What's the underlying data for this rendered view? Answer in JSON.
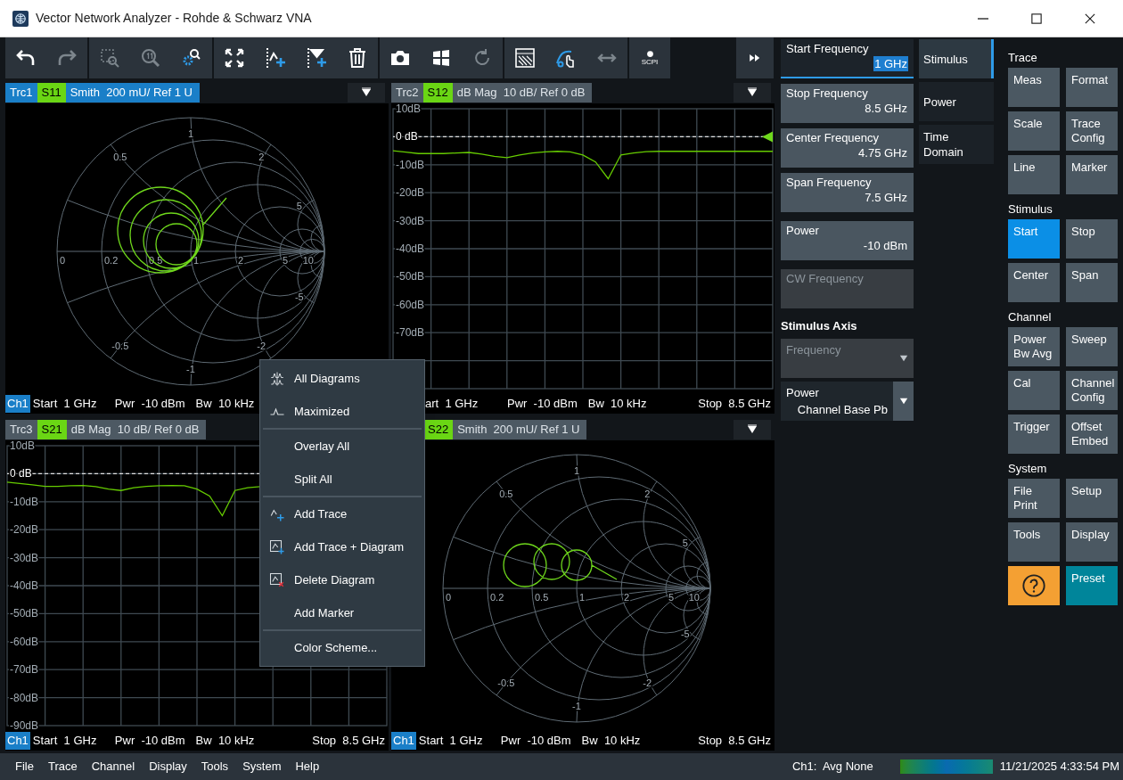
{
  "window": {
    "title": "Vector Network Analyzer - Rohde & Schwarz VNA"
  },
  "toolbar": {
    "groups": [
      [
        {
          "disabled": false
        },
        {
          "disabled": true
        }
      ],
      [
        {
          "disabled": true
        },
        {
          "disabled": true
        },
        {
          "disabled": false
        }
      ],
      [
        {
          "disabled": false
        },
        {
          "disabled": false
        },
        {
          "disabled": false
        },
        {
          "disabled": false
        }
      ],
      [
        {
          "disabled": false
        },
        {
          "disabled": false
        },
        {
          "disabled": true
        }
      ],
      [
        {
          "disabled": false
        },
        {
          "disabled": false
        },
        {
          "disabled": true
        }
      ],
      [
        {
          "disabled": false,
          "label": "SCPI"
        }
      ]
    ]
  },
  "diagrams": [
    {
      "kind": "smith",
      "header": {
        "selected": true,
        "trace": "Trc1",
        "parameter": "S11",
        "format": "Smith  200 mU/ Ref 1 U",
        "dropdown": true
      },
      "grid_labels": [
        "0",
        "0.2",
        "0.5",
        "1",
        "2",
        "5",
        "10",
        "0.5",
        "1",
        "2",
        "5",
        "-0.5",
        "-1",
        "-2",
        "-5"
      ],
      "footer": {
        "channel": "Ch1",
        "start": "Start  1 GHz",
        "power": "Pwr  -10 dBm",
        "bandwidth": "Bw  10 kHz"
      }
    },
    {
      "kind": "line",
      "header": {
        "selected": false,
        "trace": "Trc2",
        "format": "dB Mag  10 dB/ Ref 0 dB",
        "dropdown": true
      },
      "ref_marker": true,
      "chart_data": {
        "type": "line",
        "categories": [
          null,
          null,
          null,
          null,
          null,
          null,
          null,
          null,
          null,
          null,
          null,
          null,
          null,
          null,
          null,
          null,
          null,
          null,
          null,
          null,
          null,
          null,
          null,
          null,
          null,
          null,
          null,
          null,
          null,
          null,
          null
        ],
        "series": [
          {
            "name": "S12",
            "color": "#66cc00",
            "values": [
              -5,
              -5.5,
              -6,
              -6,
              -6,
              -5.8,
              -5.6,
              -6.2,
              -7,
              -7.5,
              -6.5,
              -5.8,
              -5.4,
              -5.2,
              -5.4,
              -6.5,
              -9,
              -15,
              -6.5,
              -5.8,
              -5.3,
              -5.2,
              -5.2,
              -5.2,
              -5.2,
              -5.2,
              -5.2,
              -5.2,
              -5.2,
              -5.2,
              -5.2
            ]
          }
        ],
        "grid": true,
        "ref_lines": [
          {
            "axis": "y",
            "value": 0
          }
        ],
        "ylim": [
          -90,
          10
        ],
        "yticks": [
          {
            "value": 10,
            "label": "10dB"
          },
          {
            "value": 0,
            "label": "0 dB"
          },
          {
            "value": -10,
            "label": "-10dB"
          },
          {
            "value": -20,
            "label": "-20dB"
          },
          {
            "value": -30,
            "label": "-30dB"
          },
          {
            "value": -40,
            "label": "-40dB"
          },
          {
            "value": -50,
            "label": "-50dB"
          },
          {
            "value": -60,
            "label": "-60dB"
          },
          {
            "value": -70,
            "label": "-70dB"
          }
        ]
      },
      "footer": {
        "start": "art  1 GHz",
        "power": "Pwr  -10 dBm",
        "bandwidth": "Bw  10 kHz",
        "stop": "Stop  8.5 GHz"
      }
    },
    {
      "kind": "line",
      "header": {
        "selected": false,
        "trace": "Trc3",
        "format": "dB Mag  10 dB/ Ref 0 dB",
        "dropdown": false
      },
      "ref_marker": false,
      "chart_data": {
        "type": "line",
        "categories": [
          null,
          null,
          null,
          null,
          null,
          null,
          null,
          null,
          null,
          null,
          null,
          null,
          null,
          null,
          null,
          null,
          null,
          null,
          null,
          null,
          null,
          null,
          null,
          null,
          null,
          null,
          null,
          null,
          null,
          null,
          null
        ],
        "series": [
          {
            "name": "S21",
            "color": "#66cc00",
            "values": [
              -3,
              -3.5,
              -4,
              -4.5,
              -4.5,
              -4.3,
              -4.2,
              -4.6,
              -5.5,
              -6,
              -5,
              -4.5,
              -4.3,
              -4.2,
              -4.3,
              -5.5,
              -8,
              -15,
              -6,
              -5,
              -4.6,
              null,
              null,
              null,
              null,
              null,
              null,
              null,
              null,
              null,
              null
            ]
          }
        ],
        "grid": true,
        "ref_lines": [
          {
            "axis": "y",
            "value": 0
          }
        ],
        "ylim": [
          -90,
          10
        ],
        "yticks": [
          {
            "value": 10,
            "label": "10dB"
          },
          {
            "value": 0,
            "label": "0 dB"
          },
          {
            "value": -10,
            "label": "-10dB"
          },
          {
            "value": -20,
            "label": "-20dB"
          },
          {
            "value": -30,
            "label": "-30dB"
          },
          {
            "value": -40,
            "label": "-40dB"
          },
          {
            "value": -50,
            "label": "-50dB"
          },
          {
            "value": -60,
            "label": "-60dB"
          },
          {
            "value": -70,
            "label": "-70dB"
          },
          {
            "value": -80,
            "label": "-80dB"
          },
          {
            "value": -90,
            "label": "-90dB"
          }
        ]
      },
      "footer": {
        "channel": "Ch1",
        "start": "Start  1 GHz",
        "power": "Pwr  -10 dBm",
        "bandwidth": "Bw  10 kHz",
        "stop": "Stop  8.5 GHz"
      }
    },
    {
      "kind": "smith",
      "header": {
        "selected": false,
        "parameter": "S22",
        "format": "Smith  200 mU/ Ref 1 U",
        "dropdown": true
      },
      "grid_labels": [
        "0",
        "0.2",
        "0.5",
        "1",
        "2",
        "5",
        "10",
        "0.5",
        "1",
        "2",
        "5",
        "-0.5",
        "-1",
        "-2",
        "-5"
      ],
      "footer": {
        "channel": "Ch1",
        "start": "Start  1 GHz",
        "power": "Pwr  -10 dBm",
        "bandwidth": "Bw  10 kHz",
        "stop": "Stop  8.5 GHz"
      }
    }
  ],
  "context_menu": {
    "groups": [
      [
        {
          "label": "All Diagrams"
        },
        {
          "label": "Maximized"
        }
      ],
      [
        {
          "label": "Overlay All"
        },
        {
          "label": "Split All"
        }
      ],
      [
        {
          "label": "Add Trace"
        },
        {
          "label": "Add Trace + Diagram"
        },
        {
          "label": "Delete Diagram"
        },
        {
          "label": "Add Marker"
        }
      ],
      [
        {
          "label": "Color Scheme..."
        }
      ]
    ]
  },
  "stimulus_fields": {
    "groups": [
      [
        {
          "label": "Start Frequency",
          "value": "1 GHz",
          "selected": true,
          "disabled": false
        },
        {
          "label": "Stop Frequency",
          "value": "8.5 GHz",
          "selected": false,
          "disabled": false
        },
        {
          "label": "Center Frequency",
          "value": "4.75 GHz",
          "selected": false,
          "disabled": false
        },
        {
          "label": "Span Frequency",
          "value": "7.5 GHz",
          "selected": false,
          "disabled": false
        }
      ],
      [
        {
          "label": "Power",
          "value": "-10 dBm",
          "selected": false,
          "disabled": false
        },
        {
          "label": "CW Frequency",
          "selected": false,
          "disabled": true
        }
      ]
    ]
  },
  "stimulus_axis": {
    "title": "Stimulus Axis",
    "dropdowns": [
      {
        "label": "Frequency",
        "disabled": true
      },
      {
        "label": "Power",
        "value": "Channel Base Pb",
        "disabled": false
      }
    ]
  },
  "tabs": [
    {
      "label": "Stimulus",
      "selected": true
    },
    {
      "label": "Power",
      "selected": false
    },
    {
      "label": "Time Domain",
      "selected": false
    }
  ],
  "softkeys": [
    {
      "title": "Trace",
      "keys": [
        {
          "kind": "normal",
          "label": "Meas",
          "selected": false
        },
        {
          "kind": "normal",
          "label": "Format",
          "selected": false
        },
        {
          "kind": "normal",
          "label": "Scale",
          "selected": false
        },
        {
          "kind": "normal",
          "label": "Trace Config",
          "selected": false
        },
        {
          "kind": "normal",
          "label": "Line",
          "selected": false
        },
        {
          "kind": "normal",
          "label": "Marker",
          "selected": false
        }
      ]
    },
    {
      "title": "Stimulus",
      "keys": [
        {
          "kind": "normal",
          "label": "Start",
          "selected": true
        },
        {
          "kind": "normal",
          "label": "Stop",
          "selected": false
        },
        {
          "kind": "normal",
          "label": "Center",
          "selected": false
        },
        {
          "kind": "normal",
          "label": "Span",
          "selected": false
        }
      ]
    },
    {
      "title": "Channel",
      "keys": [
        {
          "kind": "normal",
          "label": "Power Bw Avg",
          "selected": false
        },
        {
          "kind": "normal",
          "label": "Sweep",
          "selected": false
        },
        {
          "kind": "normal",
          "label": "Cal",
          "selected": false
        },
        {
          "kind": "normal",
          "label": "Channel Config",
          "selected": false
        },
        {
          "kind": "normal",
          "label": "Trigger",
          "selected": false
        },
        {
          "kind": "normal",
          "label": "Offset Embed",
          "selected": false
        }
      ]
    },
    {
      "title": "System",
      "keys": [
        {
          "kind": "normal",
          "label": "File Print",
          "selected": false
        },
        {
          "kind": "normal",
          "label": "Setup",
          "selected": false
        },
        {
          "kind": "normal",
          "label": "Tools",
          "selected": false
        },
        {
          "kind": "normal",
          "label": "Display",
          "selected": false
        },
        {
          "kind": "help",
          "selected": false
        },
        {
          "kind": "preset",
          "label": "Preset",
          "selected": false
        }
      ]
    }
  ],
  "status_bar": {
    "menus": [
      "File",
      "Trace",
      "Channel",
      "Display",
      "Tools",
      "System",
      "Help"
    ],
    "channel_status": "Ch1:  Avg None",
    "datetime": "11/21/2025 4:33:54 PM"
  }
}
